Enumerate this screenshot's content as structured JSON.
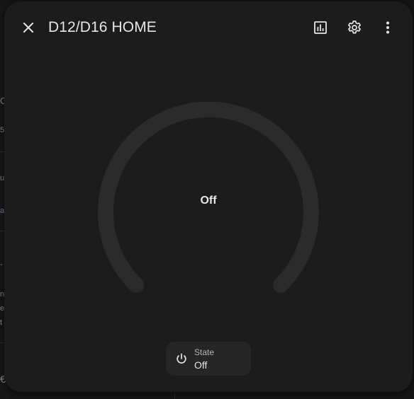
{
  "dialog": {
    "title": "D12/D16 HOME"
  },
  "gauge": {
    "value_text": "Off",
    "level_percent": 0,
    "track_color": "#2b2b2b"
  },
  "state_chip": {
    "label": "State",
    "value": "Off",
    "icon": "power-icon"
  },
  "header_icons": [
    "close-icon",
    "history-icon",
    "gear-icon",
    "more-vertical-icon"
  ],
  "colors": {
    "dialog_background": "#1c1c1c",
    "chip_background": "#262626",
    "text_primary": "#e6e6e6"
  }
}
